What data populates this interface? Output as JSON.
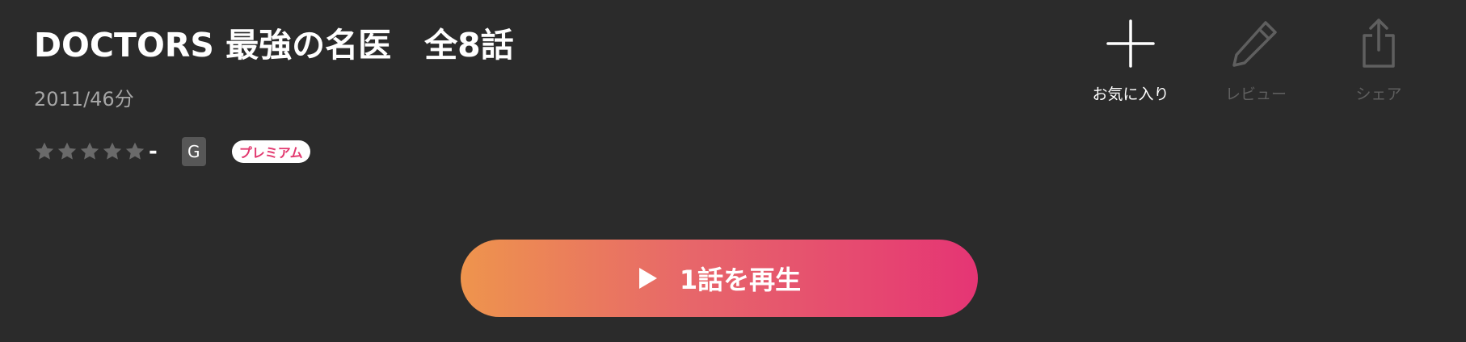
{
  "title": "DOCTORS 最強の名医　全8話",
  "meta": "2011/46分",
  "rating": {
    "stars_filled": 0,
    "stars_total": 5,
    "value": "-"
  },
  "age_rating": "G",
  "premium_badge": "プレミアム",
  "actions": {
    "favorite_label": "お気に入り",
    "review_label": "レビュー",
    "share_label": "シェア"
  },
  "play_button": {
    "label": "1話を再生"
  },
  "colors": {
    "background": "#2b2b2b",
    "star_inactive": "#6a6a6a",
    "disabled": "#5f5f5f",
    "premium_text": "#e2396f",
    "play_gradient_start": "#ee944d",
    "play_gradient_end": "#e53574"
  },
  "icons": {
    "favorite": "plus-icon",
    "review": "pencil-icon",
    "share": "share-icon",
    "play": "play-icon",
    "star": "star-icon"
  }
}
